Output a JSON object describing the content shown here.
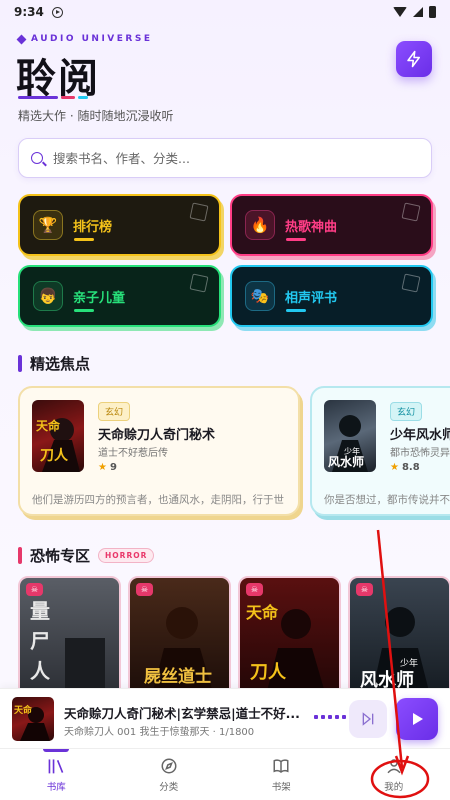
{
  "status_bar": {
    "time": "9:34"
  },
  "header": {
    "brand_tag": "AUDIO UNIVERSE",
    "title": "聆阅",
    "subtitle": "精选大作 · 随时随地沉浸收听"
  },
  "search": {
    "placeholder": "搜索书名、作者、分类..."
  },
  "categories": [
    {
      "label": "排行榜",
      "icon": "trophy-icon",
      "color": "#f4c21a"
    },
    {
      "label": "热歌神曲",
      "icon": "fire-icon",
      "color": "#ff3d86"
    },
    {
      "label": "亲子儿童",
      "icon": "child-icon",
      "color": "#27e07a"
    },
    {
      "label": "相声评书",
      "icon": "mask-icon",
      "color": "#22c8f0"
    }
  ],
  "featured": {
    "title": "精选焦点",
    "items": [
      {
        "genre": "玄幻",
        "name": "天命赊刀人奇门秘术",
        "author": "道士不好惹后传",
        "rating": "9",
        "desc": "他们是游历四方的预言者，也通风水，走阴阳，行于世"
      },
      {
        "genre": "玄幻",
        "name": "少年风水师",
        "author": "都市恐怖灵异",
        "rating": "8.8",
        "desc": "你是否想过，都市传说并不仅"
      }
    ]
  },
  "horror": {
    "title": "恐怖专区",
    "badge": "HORROR",
    "covers": [
      {
        "title": "量尸人"
      },
      {
        "title": "屍丝道士"
      },
      {
        "title": "天命赊刀人"
      },
      {
        "title": "少年风水师"
      }
    ]
  },
  "player": {
    "title": "天命赊刀人奇门秘术|玄学禁忌|道士不好...",
    "subtitle": "天命赊刀人 001 我生于惊蛰那天 · 1/1800"
  },
  "tabs": [
    {
      "label": "书库",
      "icon": "library-icon",
      "active": true
    },
    {
      "label": "分类",
      "icon": "compass-icon",
      "active": false
    },
    {
      "label": "书架",
      "icon": "book-icon",
      "active": false
    },
    {
      "label": "我的",
      "icon": "profile-icon",
      "active": false
    }
  ],
  "colors": {
    "accent": "#6a32d8",
    "horror": "#e6386a",
    "annotation": "#e01010"
  }
}
